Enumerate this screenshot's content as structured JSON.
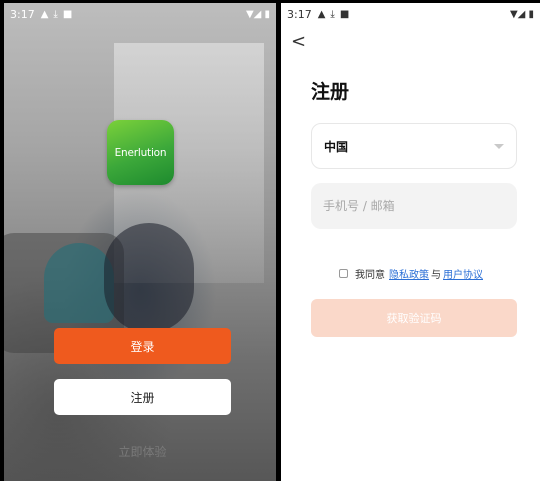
{
  "left_screen": {
    "status": {
      "time": "3:17",
      "right_icons": "▼◢ ▮"
    },
    "logo_text": "Enerlution",
    "login_label": "登录",
    "register_label": "注册",
    "trial_label": "立即体验"
  },
  "right_screen": {
    "status": {
      "time": "3:17",
      "right_icons": "▼◢ ▮"
    },
    "back_glyph": "<",
    "title": "注册",
    "country_value": "中国",
    "account_placeholder": "手机号 / 邮箱",
    "agree": {
      "prefix": "我同意",
      "privacy_link": "隐私政策",
      "and": "与",
      "terms_link": "用户协议"
    },
    "get_code_label": "获取验证码"
  },
  "colors": {
    "brand_orange": "#ef5a1e",
    "disabled_orange": "#fad8c9",
    "link_blue": "#2b6fd6",
    "logo_green": "#3ca83a"
  },
  "icons": [
    "warning-icon",
    "download-icon",
    "notification-icon",
    "wifi-icon",
    "signal-icon",
    "battery-icon",
    "back-icon",
    "chevron-down-icon",
    "checkbox-icon"
  ]
}
